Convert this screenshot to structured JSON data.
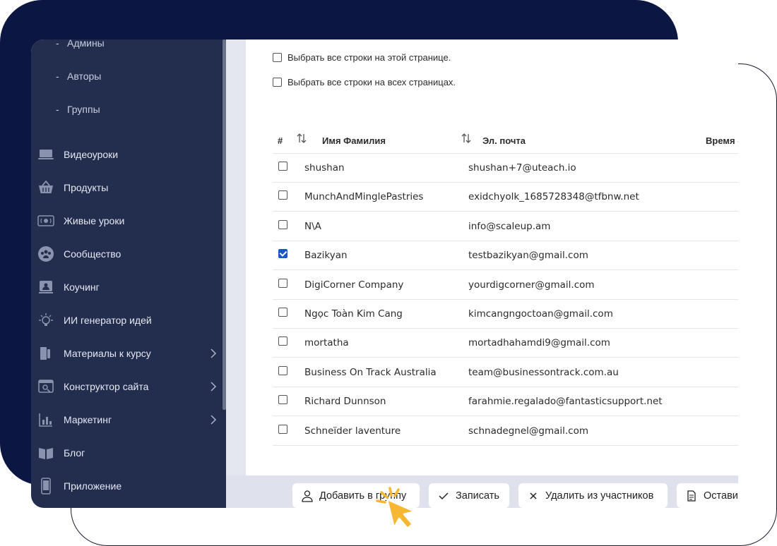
{
  "sidebar": {
    "sub_items": [
      "Админы",
      "Авторы",
      "Группы"
    ],
    "items": [
      {
        "label": "Видеоуроки",
        "icon": "laptop-icon",
        "chevron": false
      },
      {
        "label": "Продукты",
        "icon": "basket-icon",
        "chevron": false
      },
      {
        "label": "Живые уроки",
        "icon": "live-camera-icon",
        "chevron": false
      },
      {
        "label": "Сообщество",
        "icon": "community-icon",
        "chevron": false
      },
      {
        "label": "Коучинг",
        "icon": "coaching-icon",
        "chevron": false
      },
      {
        "label": "ИИ генератор идей",
        "icon": "ai-idea-icon",
        "chevron": false
      },
      {
        "label": "Материалы к курсу",
        "icon": "materials-icon",
        "chevron": true
      },
      {
        "label": "Конструктор сайта",
        "icon": "site-builder-icon",
        "chevron": true
      },
      {
        "label": "Маркетинг",
        "icon": "marketing-chart-icon",
        "chevron": true
      },
      {
        "label": "Блог",
        "icon": "blog-book-icon",
        "chevron": false
      },
      {
        "label": "Приложение",
        "icon": "mobile-app-icon",
        "chevron": false
      }
    ]
  },
  "selection": {
    "page": "Выбрать все строки на этой странице.",
    "all": "Выбрать все строки на всех страницах."
  },
  "table": {
    "headers": {
      "index": "#",
      "name": "Имя Фамилия",
      "email": "Эл. почта",
      "time": "Время с"
    },
    "rows": [
      {
        "name": "shushan",
        "email": "shushan+7@uteach.io",
        "checked": false
      },
      {
        "name": "MunchAndMinglePastries",
        "email": "exidchyolk_1685728348@tfbnw.net",
        "checked": false
      },
      {
        "name": "N\\A",
        "email": "info@scaleup.am",
        "checked": false
      },
      {
        "name": "Bazikyan",
        "email": "testbazikyan@gmail.com",
        "checked": true
      },
      {
        "name": "DigiCorner Company",
        "email": "yourdigcorner@gmail.com",
        "checked": false
      },
      {
        "name": "Ngọc Toàn Kim Cang",
        "email": "kimcangngoctoan@gmail.com",
        "checked": false
      },
      {
        "name": "mortatha",
        "email": "mortadhahamdi9@gmail.com",
        "checked": false
      },
      {
        "name": "Business On Track Australia",
        "email": "team@businessontrack.com.au",
        "checked": false
      },
      {
        "name": "Richard Dunnson",
        "email": "farahmie.regalado@fantasticsupport.net",
        "checked": false
      },
      {
        "name": "Schneïder laventure",
        "email": "schnadegnel@gmail.com",
        "checked": false
      }
    ]
  },
  "actions": {
    "add_to_group": "Добавить в группу",
    "enroll": "Записать",
    "remove": "Удалить из участников",
    "leave": "Остави"
  },
  "colors": {
    "navy_background": "#0c1642",
    "sidebar": "#232d4e",
    "checkbox_checked": "#1a56c8",
    "cursor": "#f7b733"
  }
}
